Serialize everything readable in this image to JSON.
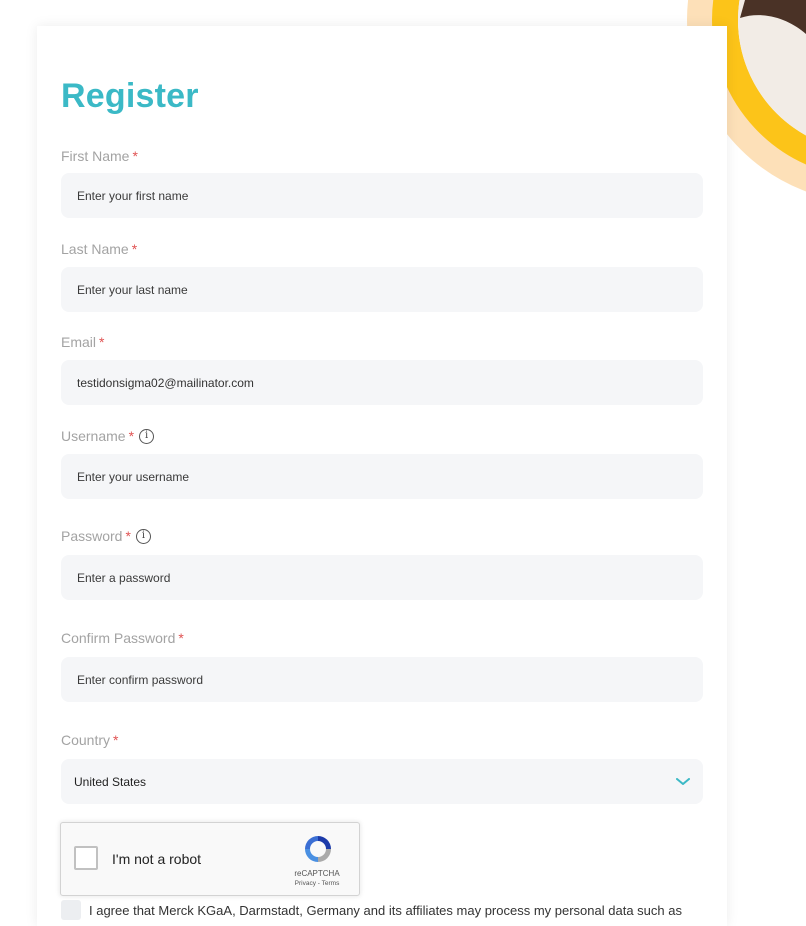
{
  "page": {
    "title": "Register"
  },
  "form": {
    "first_name": {
      "label": "First Name",
      "required_mark": "*",
      "placeholder": "Enter your first name",
      "value": ""
    },
    "last_name": {
      "label": "Last Name",
      "required_mark": "*",
      "placeholder": "Enter your last name",
      "value": ""
    },
    "email": {
      "label": "Email",
      "required_mark": "*",
      "placeholder": "",
      "value": "testidonsigma02@mailinator.com"
    },
    "username": {
      "label": "Username",
      "required_mark": "*",
      "info_glyph": "i",
      "placeholder": "Enter your username",
      "value": ""
    },
    "password": {
      "label": "Password",
      "required_mark": "*",
      "info_glyph": "i",
      "placeholder": "Enter a password",
      "value": ""
    },
    "confirm_password": {
      "label": "Confirm Password",
      "required_mark": "*",
      "placeholder": "Enter confirm password",
      "value": ""
    },
    "country": {
      "label": "Country",
      "required_mark": "*",
      "selected": "United States",
      "icon": "chevron-down-icon"
    }
  },
  "recaptcha": {
    "label": "I'm not a robot",
    "brand": "reCAPTCHA",
    "links": "Privacy - Terms",
    "icon": "recaptcha-logo-icon"
  },
  "consent": {
    "text": "I agree that Merck KGaA, Darmstadt, Germany and its affiliates may process my personal data such as"
  },
  "colors": {
    "accent": "#3bb9c6",
    "required": "#e05252",
    "field_bg": "#f5f6f8",
    "decor_yellow": "#fcc419",
    "decor_peach": "#fde0b8"
  }
}
